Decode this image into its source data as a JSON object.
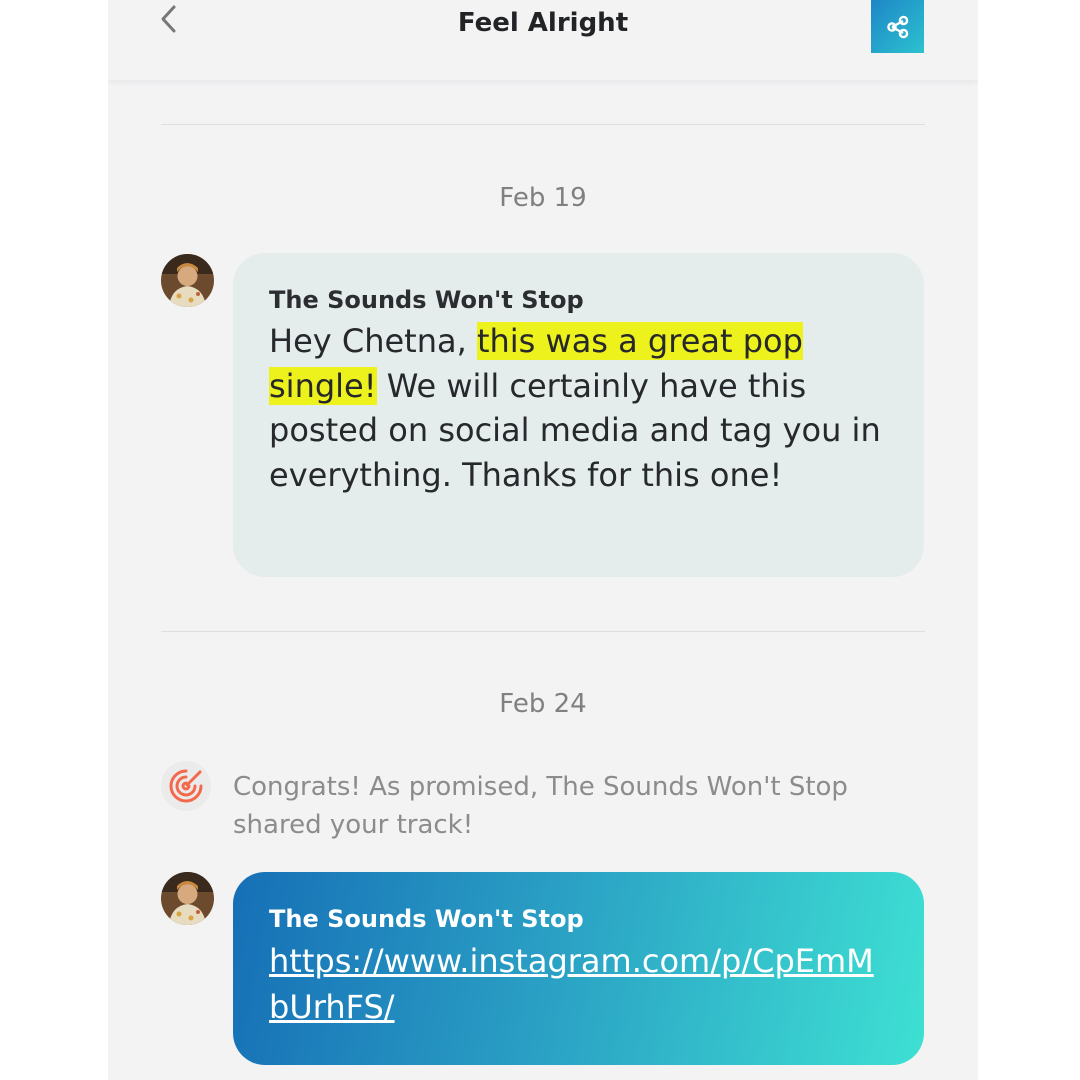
{
  "header": {
    "title": "Feel Alright",
    "back_icon": "chevron-left-icon",
    "share_icon": "share-icon"
  },
  "colors": {
    "background": "#f3f3f4",
    "bubble_light": "#e4ecec",
    "highlight": "#eef21c",
    "gradient_start": "#166fb6",
    "gradient_end": "#3ee0d3",
    "accent_orange": "#f26a4b"
  },
  "thread": [
    {
      "date": "Feb 19",
      "message": {
        "sender": "The Sounds Won't Stop",
        "text_before": "Hey Chetna, ",
        "text_highlight": "this was a great pop single!",
        "text_after": " We will certainly have this posted on social media and tag you in everything. Thanks for this one!"
      }
    },
    {
      "date": "Feb 24",
      "system_notice": "Congrats! As promised, The Sounds Won't Stop shared your track!",
      "message": {
        "sender": "The Sounds Won't Stop",
        "link": "https://www.instagram.com/p/CpEmMbUrhFS/"
      }
    }
  ]
}
